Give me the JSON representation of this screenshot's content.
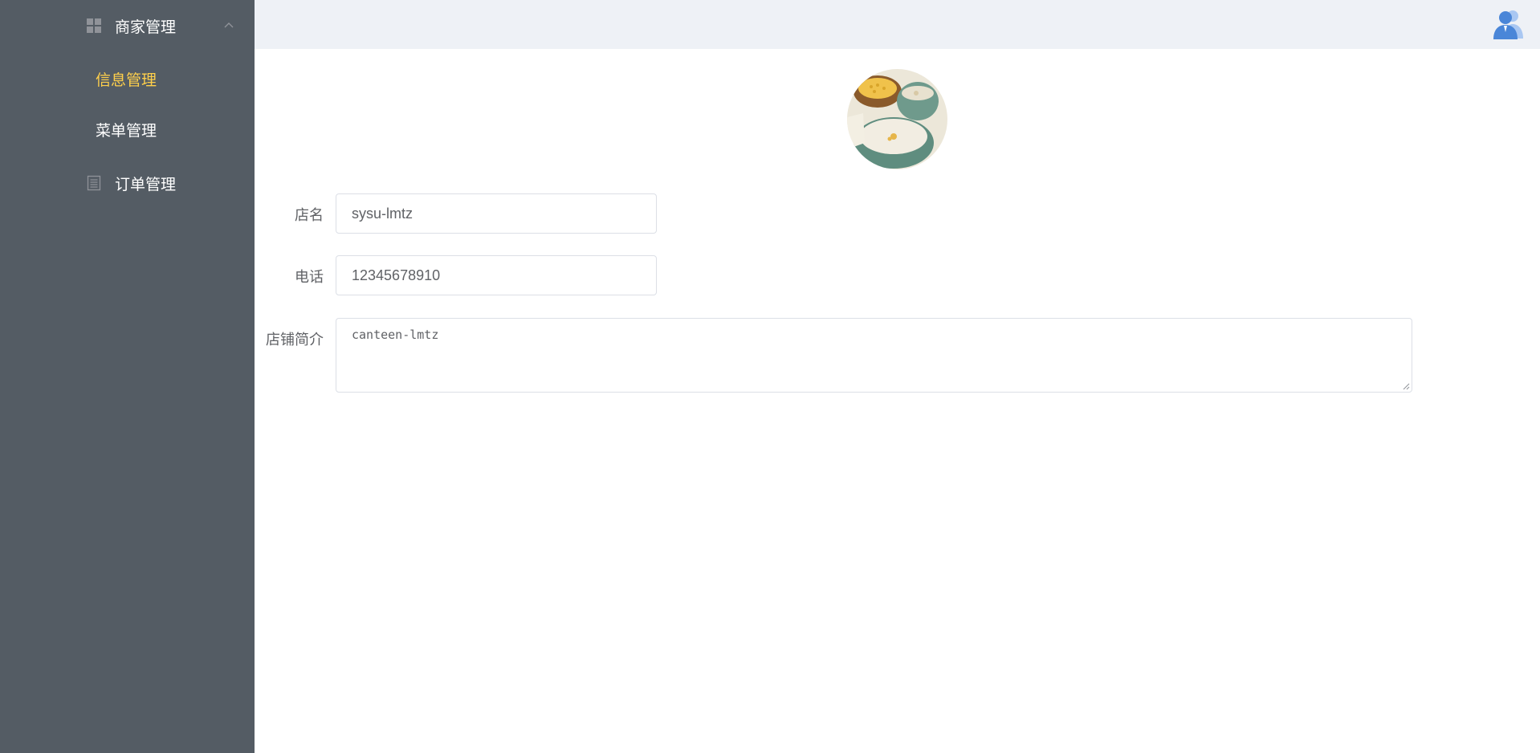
{
  "sidebar": {
    "merchant_menu": {
      "label": "商家管理",
      "icon": "grid-icon",
      "expanded": true,
      "items": [
        {
          "label": "信息管理",
          "active": true
        },
        {
          "label": "菜单管理",
          "active": false
        }
      ]
    },
    "orders_menu": {
      "label": "订单管理",
      "icon": "document-icon"
    },
    "colors": {
      "background": "#545c64",
      "text": "#ffffff",
      "active_text": "#ffd04b"
    }
  },
  "header": {
    "background": "#eef1f6",
    "avatar_icon": "user-avatar-icon"
  },
  "form": {
    "shop_image": "soup-bowls-photo",
    "fields": {
      "name": {
        "label": "店名",
        "value": "sysu-lmtz"
      },
      "phone": {
        "label": "电话",
        "value": "12345678910"
      },
      "intro": {
        "label": "店铺简介",
        "value": "canteen-lmtz"
      }
    }
  }
}
